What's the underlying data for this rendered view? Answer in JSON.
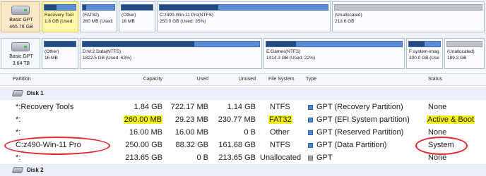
{
  "disk1": {
    "type": "Basic GPT",
    "size": "465.76 GB",
    "partitions": [
      {
        "name": "Recovery Tool",
        "detail": "1.8 GB (Used:",
        "used_fraction": 0.39
      },
      {
        "name": "(FAT32)",
        "detail": "260 MB (Used:",
        "used_fraction": 0.11
      },
      {
        "name": "(Other)",
        "detail": "16 MB",
        "used_fraction": 1.0
      },
      {
        "name": "C:z490-Win-11 Pro(NTFS)",
        "detail": "250.0 GB (Used: 35%)",
        "used_fraction": 0.35
      },
      {
        "name": "(Unallocated)",
        "detail": "213.6 GB",
        "used_fraction": 0
      }
    ]
  },
  "disk2": {
    "type": "Basic GPT",
    "size": "3.64 TB",
    "partitions": [
      {
        "name": "(Other)",
        "detail": "16 MB",
        "used_fraction": 1.0
      },
      {
        "name": "D:M.2 Data(NTFS)",
        "detail": "1822.5 GB (Used: 63%)",
        "used_fraction": 0.63
      },
      {
        "name": "E:Games(NTFS)",
        "detail": "1414.3 GB (Used: 22%)",
        "used_fraction": 0.22
      },
      {
        "name": "F:system-imag",
        "detail": "300.0 GB (Use",
        "used_fraction": 0.5
      },
      {
        "name": "(Unallocated)",
        "detail": "189.3 GB",
        "used_fraction": 0
      }
    ]
  },
  "columns": {
    "partition": "Partition",
    "capacity": "Capacity",
    "used": "Used",
    "unused": "Unused",
    "filesystem": "File System",
    "type": "Type",
    "status": "Status"
  },
  "groups": {
    "disk1": "Disk 1",
    "disk2": "Disk 2"
  },
  "rows": [
    {
      "partition": "*:Recovery Tools",
      "capacity": "1.84 GB",
      "used": "722.17 MB",
      "unused": "1.14 GB",
      "filesystem": "NTFS",
      "type": "GPT (Recovery Partition)",
      "status": "None"
    },
    {
      "partition": "*:",
      "capacity": "260.00 MB",
      "used": "29.23 MB",
      "unused": "230.77 MB",
      "filesystem": "FAT32",
      "type": "GPT (EFI System partition)",
      "status": "Active & Boot"
    },
    {
      "partition": "*:",
      "capacity": "16.00 MB",
      "used": "16.00 MB",
      "unused": "0 B",
      "filesystem": "Other",
      "type": "GPT (Reserved Partition)",
      "status": "None"
    },
    {
      "partition": "C:z490-Win-11 Pro",
      "capacity": "250.00 GB",
      "used": "88.32 GB",
      "unused": "161.68 GB",
      "filesystem": "NTFS",
      "type": "GPT (Data Partition)",
      "status": "System"
    },
    {
      "partition": "*:",
      "capacity": "213.65 GB",
      "used": "0 B",
      "unused": "213.65 GB",
      "filesystem": "Unallocated",
      "type": "GPT",
      "status": "None"
    }
  ],
  "colors": {
    "highlight": "#f3f21a",
    "annotation_circle": "#e4262e",
    "used_bar": "#24497f",
    "free_bar": "#5b8ed6"
  }
}
